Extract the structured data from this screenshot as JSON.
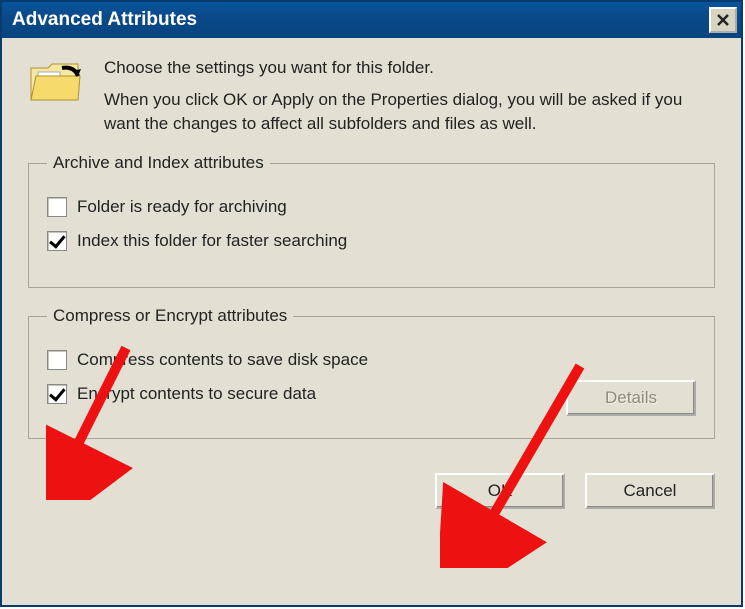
{
  "window": {
    "title": "Advanced Attributes",
    "close_tooltip": "Close"
  },
  "intro": {
    "line1": "Choose the settings you want for this folder.",
    "line2": "When you click OK or Apply on the Properties dialog, you will be asked if you want the changes to affect all subfolders and files as well."
  },
  "group_archive": {
    "legend": "Archive and Index attributes",
    "items": [
      {
        "label": "Folder is ready for archiving",
        "checked": false
      },
      {
        "label": "Index this folder for faster searching",
        "checked": true
      }
    ]
  },
  "group_compress": {
    "legend": "Compress or Encrypt attributes",
    "items": [
      {
        "label": "Compress contents to save disk space",
        "checked": false
      },
      {
        "label": "Encrypt contents to secure data",
        "checked": true
      }
    ],
    "details_btn": "Details"
  },
  "buttons": {
    "ok": "OK",
    "cancel": "Cancel"
  }
}
